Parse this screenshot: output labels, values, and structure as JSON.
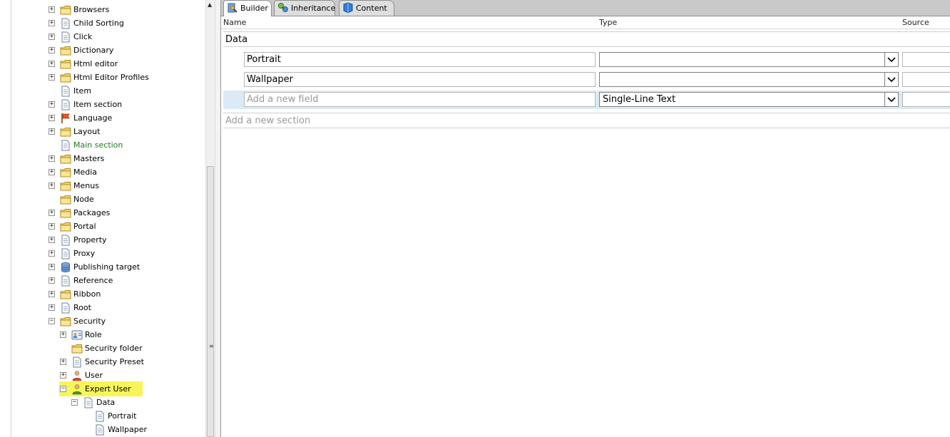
{
  "tree": {
    "items": [
      {
        "label": "Browsers",
        "icon": "folder-icon",
        "expander": "+"
      },
      {
        "label": "Child Sorting",
        "icon": "document-icon",
        "expander": "+"
      },
      {
        "label": "Click",
        "icon": "document-icon",
        "expander": "+"
      },
      {
        "label": "Dictionary",
        "icon": "folder-icon",
        "expander": "+"
      },
      {
        "label": "Html editor",
        "icon": "folder-icon",
        "expander": "+"
      },
      {
        "label": "Html Editor Profiles",
        "icon": "folder-icon",
        "expander": "+"
      },
      {
        "label": "Item",
        "icon": "document-icon",
        "expander": ""
      },
      {
        "label": "Item section",
        "icon": "document-icon",
        "expander": "+"
      },
      {
        "label": "Language",
        "icon": "flag-icon",
        "expander": "+"
      },
      {
        "label": "Layout",
        "icon": "folder-icon",
        "expander": "+"
      },
      {
        "label": "Main section",
        "icon": "document-icon",
        "expander": ""
      },
      {
        "label": "Masters",
        "icon": "folder-icon",
        "expander": "+"
      },
      {
        "label": "Media",
        "icon": "folder-icon",
        "expander": "+"
      },
      {
        "label": "Menus",
        "icon": "folder-icon",
        "expander": "+"
      },
      {
        "label": "Node",
        "icon": "folder-icon",
        "expander": ""
      },
      {
        "label": "Packages",
        "icon": "folder-icon",
        "expander": "+"
      },
      {
        "label": "Portal",
        "icon": "folder-icon",
        "expander": "+"
      },
      {
        "label": "Property",
        "icon": "document-icon",
        "expander": "+"
      },
      {
        "label": "Proxy",
        "icon": "document-icon",
        "expander": "+"
      },
      {
        "label": "Publishing target",
        "icon": "database-icon",
        "expander": "+"
      },
      {
        "label": "Reference",
        "icon": "document-icon",
        "expander": "+"
      },
      {
        "label": "Ribbon",
        "icon": "folder-icon",
        "expander": "+"
      },
      {
        "label": "Root",
        "icon": "document-icon",
        "expander": "+"
      },
      {
        "label": "Security",
        "icon": "folder-icon",
        "expander": "-"
      },
      {
        "label": "Role",
        "icon": "role-icon",
        "expander": "+"
      },
      {
        "label": "Security folder",
        "icon": "folder-icon",
        "expander": ""
      },
      {
        "label": "Security Preset",
        "icon": "document-icon",
        "expander": "+"
      },
      {
        "label": "User",
        "icon": "user-icon",
        "expander": "+"
      },
      {
        "label": "Expert User",
        "icon": "user-green-icon",
        "expander": "-"
      },
      {
        "label": "Data",
        "icon": "document-icon",
        "expander": "-"
      },
      {
        "label": "Portrait",
        "icon": "document-icon",
        "expander": ""
      },
      {
        "label": "Wallpaper",
        "icon": "document-icon",
        "expander": ""
      }
    ],
    "highlight_color": "#f6f55a",
    "green_label_color": "#1f7a1f"
  },
  "tabs": [
    {
      "label": "Builder",
      "icon": "builder-icon",
      "active": true
    },
    {
      "label": "Inheritance",
      "icon": "inheritance-icon",
      "active": false
    },
    {
      "label": "Content",
      "icon": "content-icon",
      "active": false
    }
  ],
  "columns": {
    "name": "Name",
    "type": "Type",
    "source": "Source"
  },
  "section": {
    "name": "Data"
  },
  "fields": [
    {
      "name": "Portrait",
      "type": ""
    },
    {
      "name": "Wallpaper",
      "type": ""
    }
  ],
  "new_field": {
    "placeholder": "Add a new field",
    "type": "Single-Line Text"
  },
  "new_section": {
    "placeholder": "Add a new section"
  },
  "colors": {
    "new_row_bg": "#dbeaf7",
    "tab_bar_bg": "#c9c9c9"
  }
}
